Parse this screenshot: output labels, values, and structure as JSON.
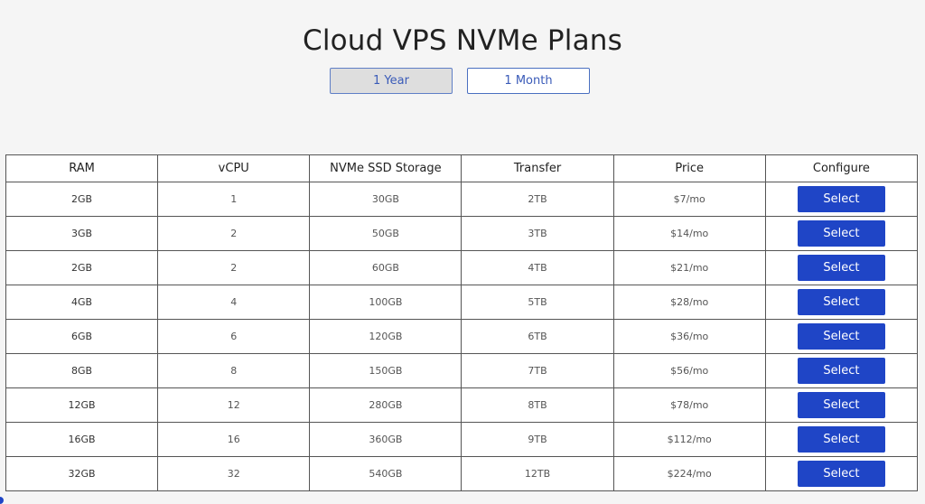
{
  "page": {
    "title": "Cloud VPS NVMe Plans"
  },
  "billing_toggle": {
    "options": [
      {
        "label": "1 Year",
        "active": true
      },
      {
        "label": "1 Month",
        "active": false
      }
    ]
  },
  "colors": {
    "accent": "#1f45c6",
    "toggle_border": "#4a6fc0",
    "toggle_active_bg": "#dedede"
  },
  "table": {
    "headers": [
      "RAM",
      "vCPU",
      "NVMe SSD Storage",
      "Transfer",
      "Price",
      "Configure"
    ],
    "rows": [
      {
        "ram": "2GB",
        "vcpu": "1",
        "storage": "30GB",
        "transfer": "2TB",
        "price": "$7/mo",
        "action": "Select"
      },
      {
        "ram": "3GB",
        "vcpu": "2",
        "storage": "50GB",
        "transfer": "3TB",
        "price": "$14/mo",
        "action": "Select"
      },
      {
        "ram": "2GB",
        "vcpu": "2",
        "storage": "60GB",
        "transfer": "4TB",
        "price": "$21/mo",
        "action": "Select"
      },
      {
        "ram": "4GB",
        "vcpu": "4",
        "storage": "100GB",
        "transfer": "5TB",
        "price": "$28/mo",
        "action": "Select"
      },
      {
        "ram": "6GB",
        "vcpu": "6",
        "storage": "120GB",
        "transfer": "6TB",
        "price": "$36/mo",
        "action": "Select"
      },
      {
        "ram": "8GB",
        "vcpu": "8",
        "storage": "150GB",
        "transfer": "7TB",
        "price": "$56/mo",
        "action": "Select"
      },
      {
        "ram": "12GB",
        "vcpu": "12",
        "storage": "280GB",
        "transfer": "8TB",
        "price": "$78/mo",
        "action": "Select"
      },
      {
        "ram": "16GB",
        "vcpu": "16",
        "storage": "360GB",
        "transfer": "9TB",
        "price": "$112/mo",
        "action": "Select"
      },
      {
        "ram": "32GB",
        "vcpu": "32",
        "storage": "540GB",
        "transfer": "12TB",
        "price": "$224/mo",
        "action": "Select"
      }
    ]
  }
}
